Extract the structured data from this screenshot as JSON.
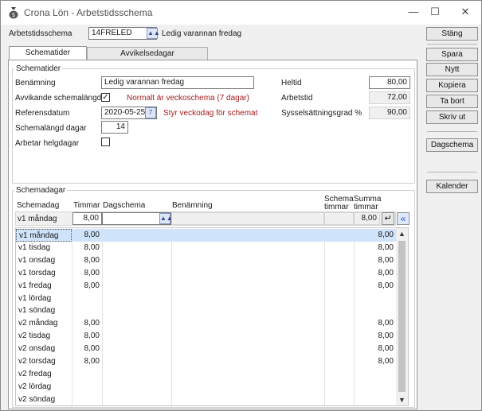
{
  "window": {
    "title": "Crona Lön - Arbetstidsschema",
    "minimize_glyph": "—",
    "maximize_glyph": "☐",
    "close_glyph": "✕"
  },
  "header": {
    "schema_label": "Arbetstidsschema",
    "schema_code": "14FRELED",
    "schema_name": "Ledig varannan fredag"
  },
  "tabs": [
    {
      "label": "Schematider",
      "active": true
    },
    {
      "label": "Avvikelsedagar",
      "active": false
    }
  ],
  "schematider": {
    "group_title": "Schematider",
    "benamning_label": "Benämning",
    "benamning_value": "Ledig varannan fredag",
    "avvikande_label": "Avvikande schemalängd",
    "avvikande_checked": "✓",
    "avvikande_note": "Normalt är veckoschema (7 dagar)",
    "referensdatum_label": "Referensdatum",
    "referensdatum_value": "2020-05-25",
    "referensdatum_note": "Styr veckodag för schemat",
    "schemalangd_label": "Schemalängd dagar",
    "schemalangd_value": "14",
    "helgdagar_label": "Arbetar helgdagar",
    "heltid_label": "Heltid",
    "heltid_value": "80,00",
    "arbetstid_label": "Arbetstid",
    "arbetstid_value": "72,00",
    "syssel_label": "Sysselsättningsgrad %",
    "syssel_value": "90,00"
  },
  "schemadagar": {
    "group_title": "Schemadagar",
    "columns": {
      "schemadag": "Schemadag",
      "timmar": "Timmar",
      "dagschema": "Dagschema",
      "benamning": "Benämning",
      "schema_timmar_1": "Schema",
      "schema_timmar_2": "timmar",
      "summa_timmar_1": "Summa",
      "summa_timmar_2": "timmar"
    },
    "edit_row": {
      "schemadag": "v1 måndag",
      "timmar": "8,00",
      "summa": "8,00"
    },
    "rows": [
      {
        "dag": "v1 måndag",
        "timmar": "8,00",
        "summa": "8,00"
      },
      {
        "dag": "v1 tisdag",
        "timmar": "8,00",
        "summa": "8,00"
      },
      {
        "dag": "v1 onsdag",
        "timmar": "8,00",
        "summa": "8,00"
      },
      {
        "dag": "v1 torsdag",
        "timmar": "8,00",
        "summa": "8,00"
      },
      {
        "dag": "v1 fredag",
        "timmar": "8,00",
        "summa": "8,00"
      },
      {
        "dag": "v1 lördag",
        "timmar": "",
        "summa": ""
      },
      {
        "dag": "v1 söndag",
        "timmar": "",
        "summa": ""
      },
      {
        "dag": "v2 måndag",
        "timmar": "8,00",
        "summa": "8,00"
      },
      {
        "dag": "v2 tisdag",
        "timmar": "8,00",
        "summa": "8,00"
      },
      {
        "dag": "v2 onsdag",
        "timmar": "8,00",
        "summa": "8,00"
      },
      {
        "dag": "v2 torsdag",
        "timmar": "8,00",
        "summa": "8,00"
      },
      {
        "dag": "v2 fredag",
        "timmar": "",
        "summa": ""
      },
      {
        "dag": "v2 lördag",
        "timmar": "",
        "summa": ""
      },
      {
        "dag": "v2 söndag",
        "timmar": "",
        "summa": ""
      }
    ],
    "enter_glyph": "↵",
    "collapse_glyph": "«"
  },
  "sidebar": {
    "stang": "Stäng",
    "spara": "Spara",
    "nytt": "Nytt",
    "kopiera": "Kopiera",
    "ta_bort": "Ta bort",
    "skriv_ut": "Skriv ut",
    "dagschema": "Dagschema",
    "kalender": "Kalender"
  },
  "colors": {
    "selection": "#cfe3fa",
    "note_red": "#a51c1c",
    "lookup_blue": "#2c4a8a"
  }
}
